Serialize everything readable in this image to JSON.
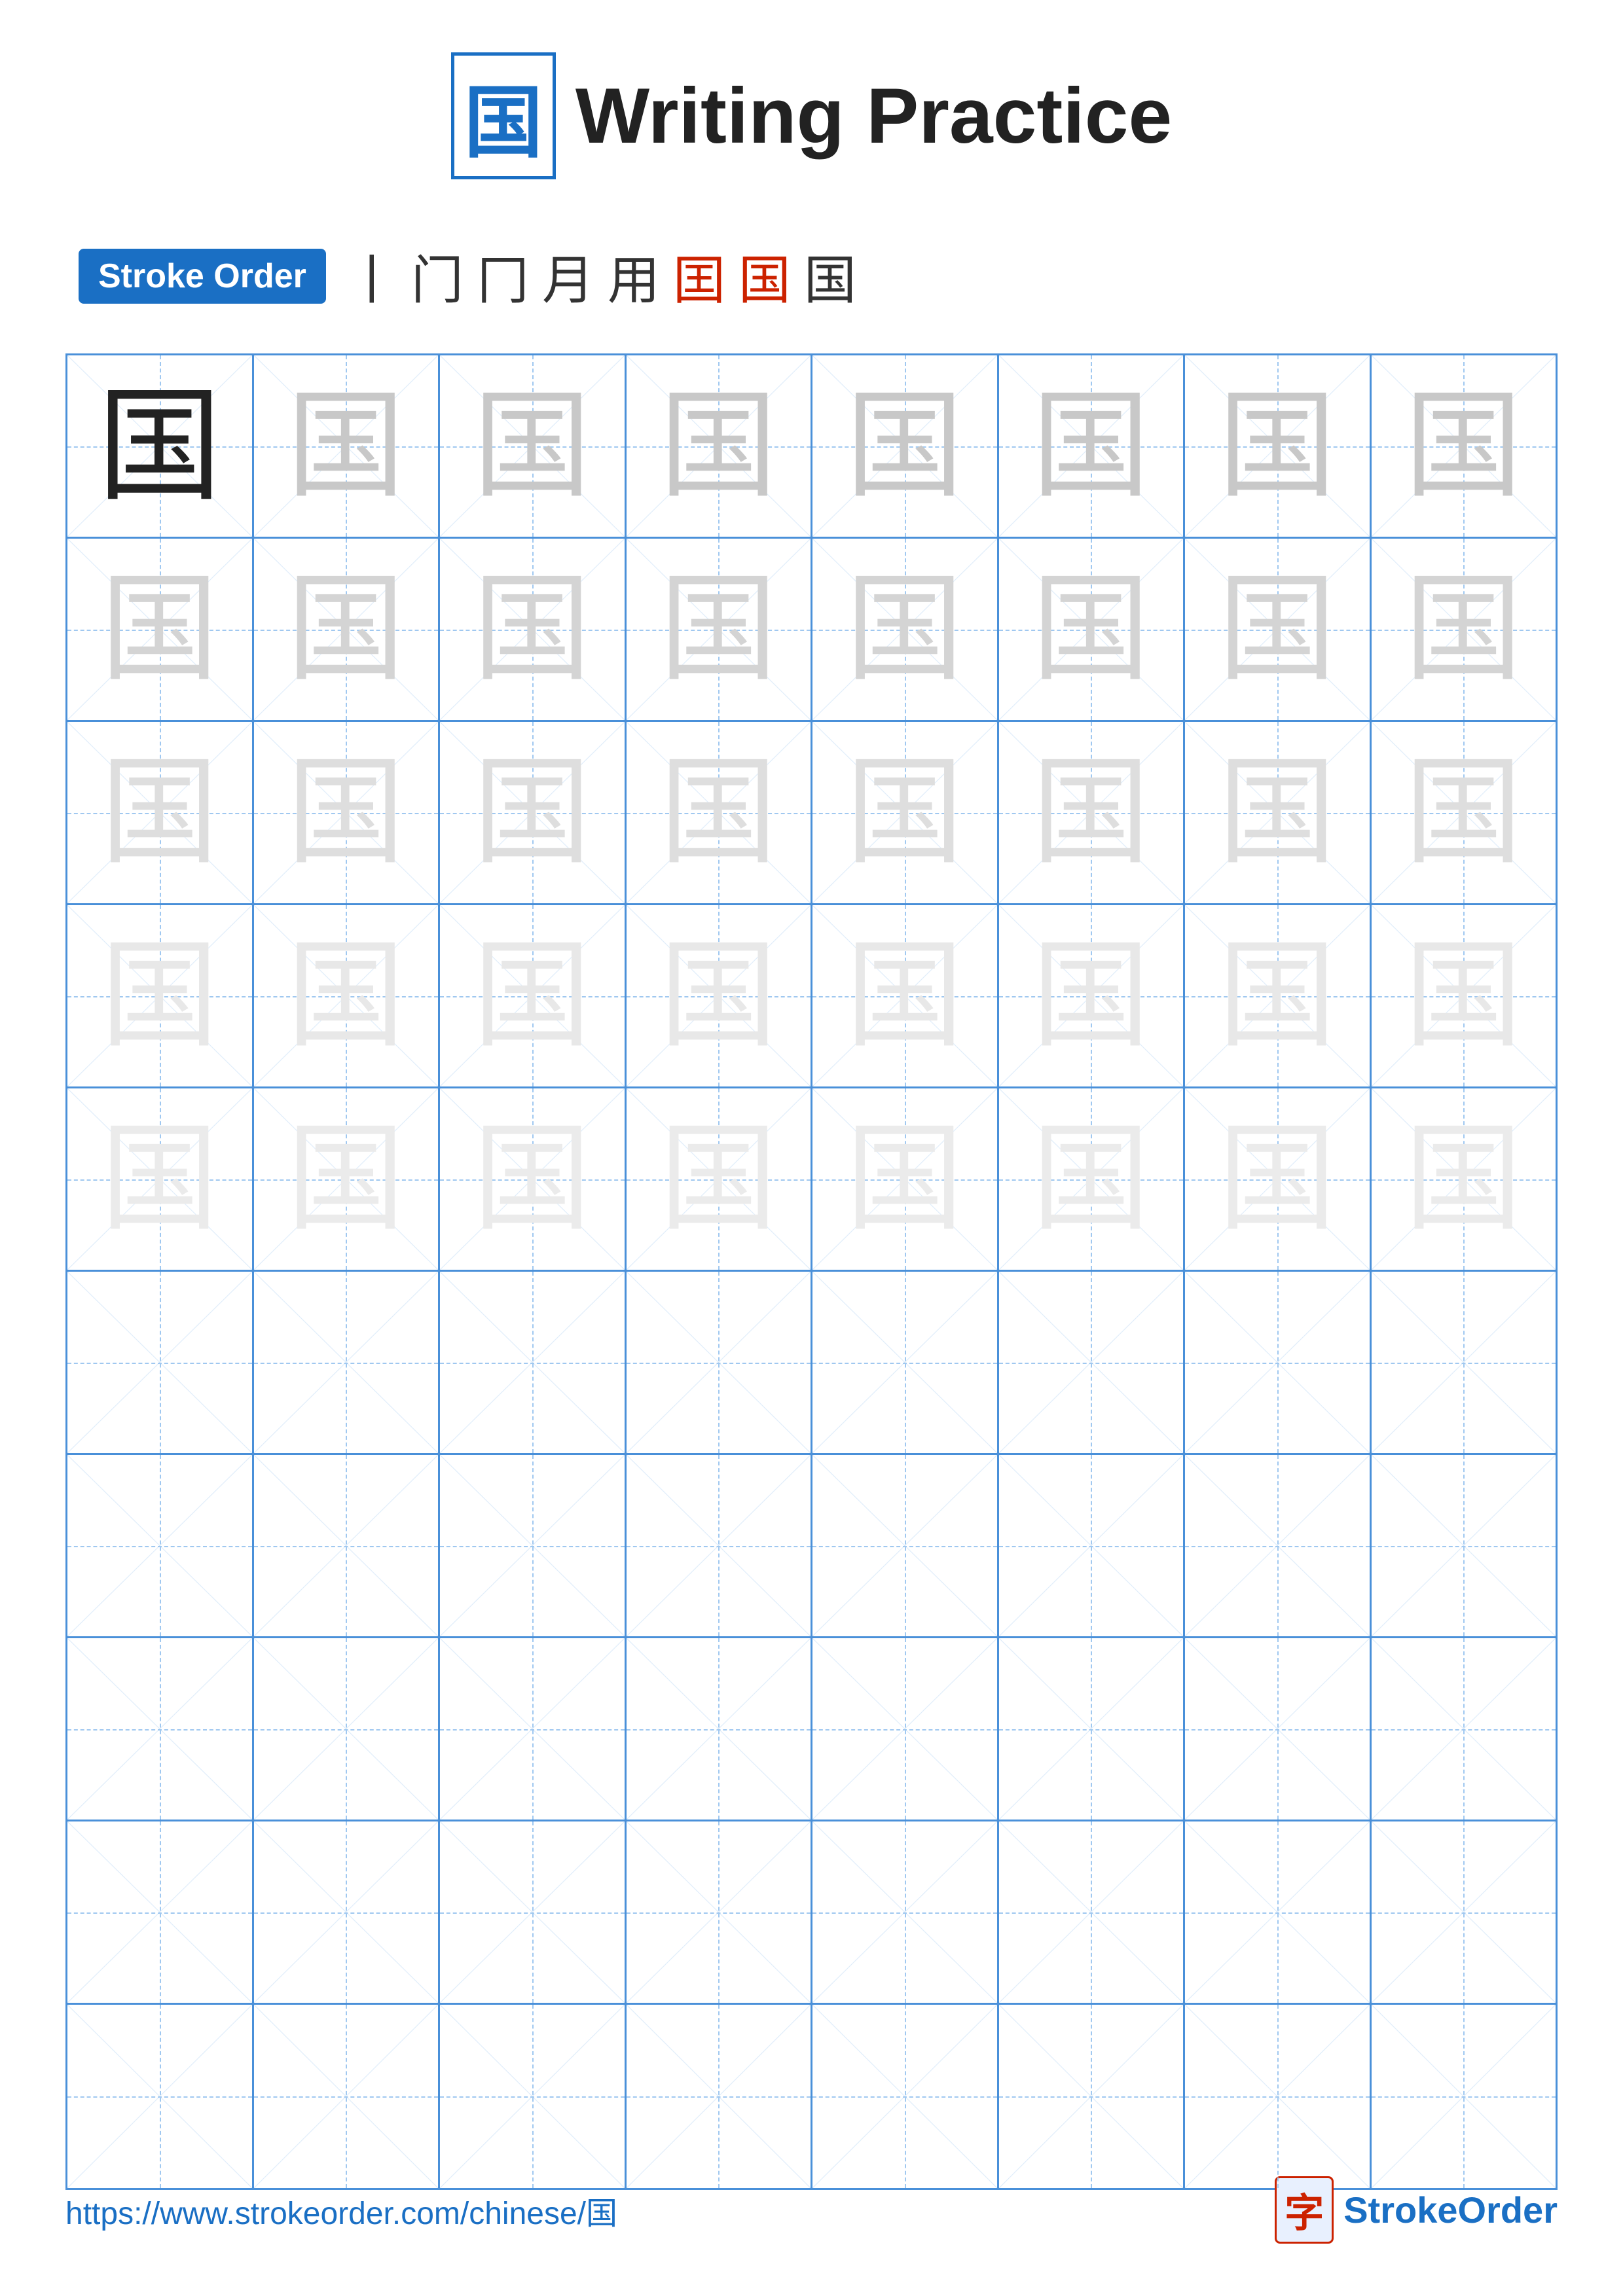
{
  "title": {
    "char": "国",
    "text": "Writing Practice"
  },
  "stroke_order": {
    "badge_label": "Stroke Order",
    "sequence": [
      "丨",
      "门",
      "冂",
      "月",
      "用",
      "囯",
      "国",
      "国"
    ]
  },
  "grid": {
    "rows": 10,
    "cols": 8,
    "practice_char": "国",
    "filled_rows": 5,
    "shade_levels": [
      "dark",
      "gray1",
      "gray2",
      "gray3",
      "gray4",
      "gray5"
    ]
  },
  "footer": {
    "url": "https://www.strokeorder.com/chinese/国",
    "logo_text": "StrokeOrder",
    "logo_char": "字"
  }
}
